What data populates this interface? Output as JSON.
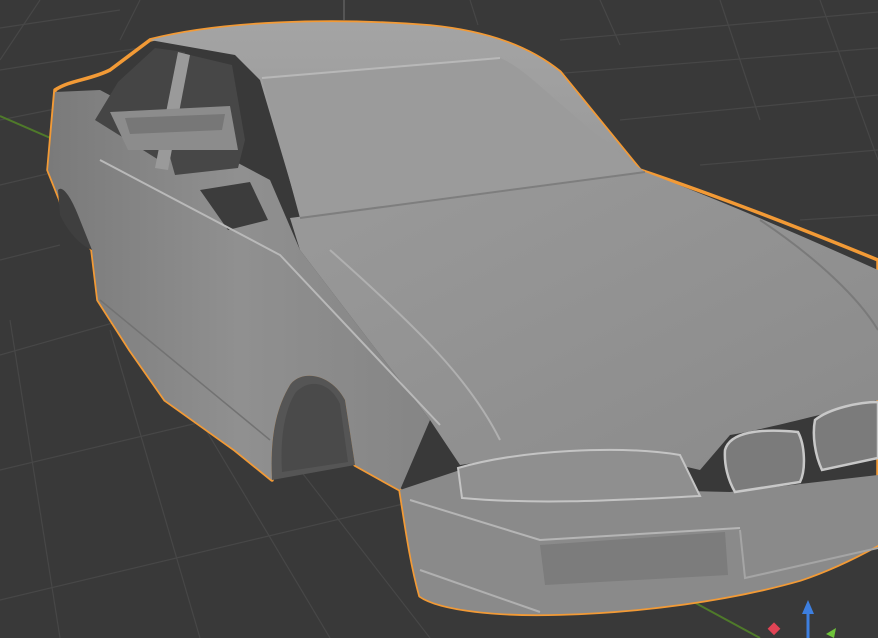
{
  "viewport": {
    "mode": "3d-viewport",
    "background_color": "#393939",
    "grid_color": "#484848",
    "axis_x_color": "#6e2f2f",
    "axis_y_color": "#4f7a2a",
    "selection_outline_color": "#f29a36"
  },
  "selected_object": {
    "type": "mesh",
    "description_icon": "car-body-mesh",
    "base_color": "#8f8f8f",
    "highlight_color": "#b4b4b4",
    "shadow_color": "#6a6a6a"
  },
  "gizmo": {
    "axes": [
      {
        "axis": "X",
        "color": "#e04455"
      },
      {
        "axis": "Y",
        "color": "#6ec33a"
      },
      {
        "axis": "Z",
        "color": "#3d7fe0"
      }
    ]
  }
}
